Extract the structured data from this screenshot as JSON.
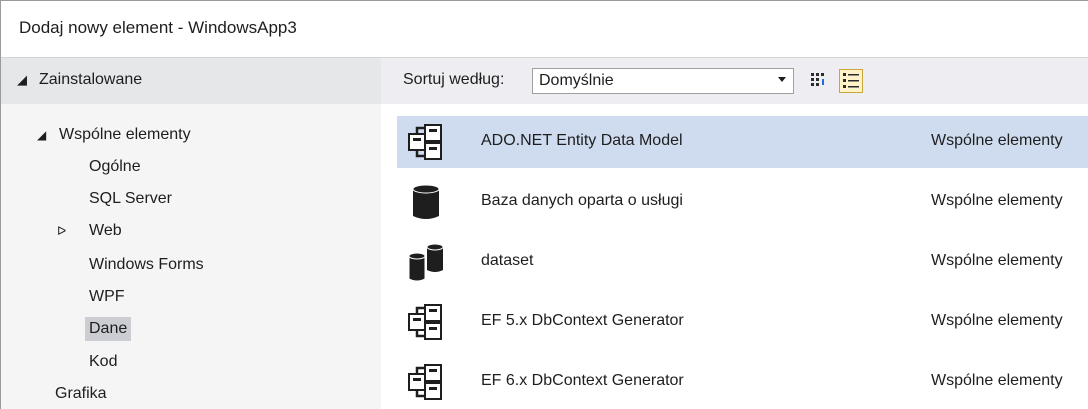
{
  "window": {
    "title": "Dodaj nowy element - WindowsApp3"
  },
  "sidebar": {
    "header": "Zainstalowane",
    "tree": [
      {
        "label": "Wspólne elementy",
        "expanded": true
      },
      {
        "label": "Ogólne"
      },
      {
        "label": "SQL Server"
      },
      {
        "label": "Web",
        "collapsed": true
      },
      {
        "label": "Windows Forms"
      },
      {
        "label": "WPF"
      },
      {
        "label": "Dane",
        "selected": true
      },
      {
        "label": "Kod"
      },
      {
        "label": "Grafika"
      }
    ]
  },
  "sortbar": {
    "label": "Sortuj według:",
    "selected": "Domyślnie"
  },
  "items": [
    {
      "name": "ADO.NET Entity Data Model",
      "category": "Wspólne elementy",
      "icon": "entity-model-icon",
      "selected": true
    },
    {
      "name": "Baza danych oparta o usługi",
      "category": "Wspólne elementy",
      "icon": "database-icon"
    },
    {
      "name": "dataset",
      "category": "Wspólne elementy",
      "icon": "dataset-icon"
    },
    {
      "name": "EF 5.x DbContext Generator",
      "category": "Wspólne elementy",
      "icon": "entity-model-icon"
    },
    {
      "name": "EF 6.x DbContext Generator",
      "category": "Wspólne elementy",
      "icon": "entity-model-icon"
    }
  ],
  "colors": {
    "selection": "#cfdcf0",
    "tree_selection": "#cbcdd2",
    "accent_toggle": "#c9a53c"
  }
}
